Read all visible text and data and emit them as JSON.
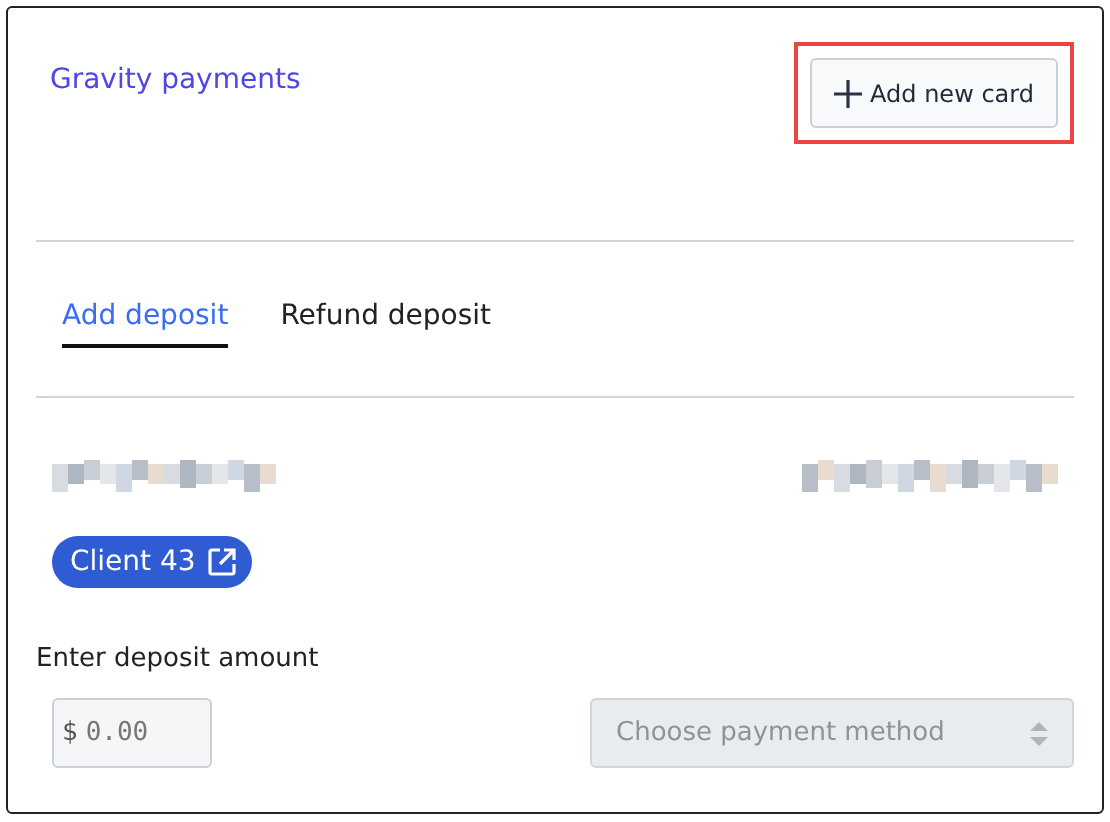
{
  "header": {
    "title": "Gravity payments",
    "add_button": {
      "label": "Add new card",
      "highlighted": true
    }
  },
  "tabs": [
    {
      "label": "Add deposit",
      "selected": true
    },
    {
      "label": "Refund deposit",
      "selected": false
    }
  ],
  "customer": {
    "name_redacted": true,
    "phone_redacted": true,
    "client_badge": "Client 43"
  },
  "deposit": {
    "label": "Enter deposit amount",
    "currency": "$",
    "placeholder": "0.00",
    "payment_method": {
      "placeholder": "Choose payment method",
      "disabled": true
    }
  }
}
